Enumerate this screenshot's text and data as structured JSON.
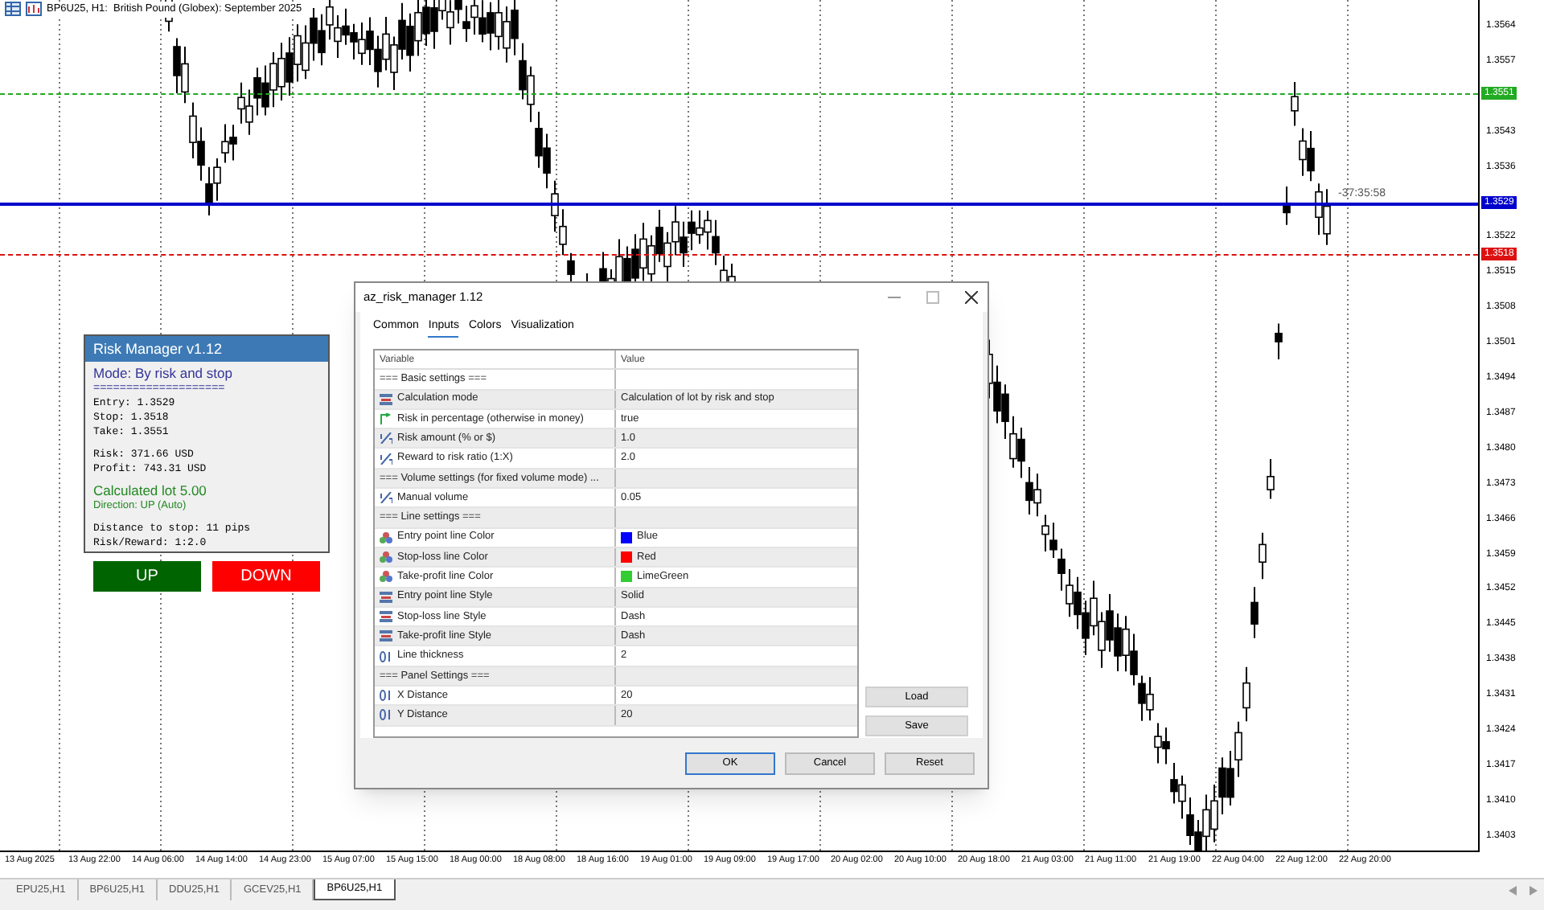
{
  "chart": {
    "title": "BP6U25, H1:  British Pound (Globex): September 2025",
    "price_labels": [
      "1.3564",
      "1.3557",
      "1.3543",
      "1.3536",
      "1.3522",
      "1.3515",
      "1.3508",
      "1.3501",
      "1.3494",
      "1.3487",
      "1.3480",
      "1.3473",
      "1.3466",
      "1.3459",
      "1.3452",
      "1.3445",
      "1.3438",
      "1.3431",
      "1.3424",
      "1.3417",
      "1.3410",
      "1.3403"
    ],
    "levels": [
      {
        "kind": "take",
        "text": "1.3551",
        "color": "#22aa22"
      },
      {
        "kind": "entry",
        "text": "1.3529",
        "color": "#0000cc"
      },
      {
        "kind": "stop",
        "text": "1.3518",
        "color": "#dd1111"
      }
    ],
    "timer": "-37:35:58",
    "time_labels": [
      "13 Aug 2025",
      "13 Aug 22:00",
      "14 Aug 06:00",
      "14 Aug 14:00",
      "14 Aug 23:00",
      "15 Aug 07:00",
      "15 Aug 15:00",
      "18 Aug 00:00",
      "18 Aug 08:00",
      "18 Aug 16:00",
      "19 Aug 01:00",
      "19 Aug 09:00",
      "19 Aug 17:00",
      "20 Aug 02:00",
      "20 Aug 10:00",
      "20 Aug 18:00",
      "21 Aug 03:00",
      "21 Aug 11:00",
      "21 Aug 19:00",
      "22 Aug 04:00",
      "22 Aug 12:00",
      "22 Aug 20:00"
    ]
  },
  "risk_panel": {
    "title": "Risk Manager v1.12",
    "groups": [
      [
        {
          "kind": "mode",
          "text": "Mode: By risk and stop"
        },
        {
          "kind": "rule",
          "text": "===================="
        },
        {
          "kind": "mono",
          "text": "Entry: 1.3529"
        },
        {
          "kind": "mono",
          "text": "Stop: 1.3518"
        },
        {
          "kind": "mono",
          "text": "Take: 1.3551"
        }
      ],
      [
        {
          "kind": "mono",
          "text": "Risk: 371.66 USD"
        },
        {
          "kind": "mono",
          "text": "Profit: 743.31 USD"
        }
      ],
      [
        {
          "kind": "lot",
          "text": "Calculated lot 5.00"
        },
        {
          "kind": "direction",
          "text": "Direction: UP (Auto)"
        }
      ],
      [
        {
          "kind": "mono",
          "text": "Distance to stop: 11 pips"
        },
        {
          "kind": "mono",
          "text": "Risk/Reward: 1:2.0"
        }
      ]
    ],
    "buttons": [
      {
        "label": "UP",
        "color": "#006400"
      },
      {
        "label": "DOWN",
        "color": "#ff0000"
      }
    ]
  },
  "dialog": {
    "title": "az_risk_manager 1.12",
    "tabs": [
      {
        "label": "Common",
        "selected": false
      },
      {
        "label": "Inputs",
        "selected": true
      },
      {
        "label": "Colors",
        "selected": false
      },
      {
        "label": "Visualization",
        "selected": false
      }
    ],
    "columns": [
      "Variable",
      "Value"
    ],
    "rows": [
      {
        "kind": "section",
        "variable": "=== Basic settings ==="
      },
      {
        "kind": "enum",
        "variable": "Calculation mode",
        "value": "Calculation of lot by risk and stop"
      },
      {
        "kind": "bool",
        "variable": "Risk in percentage (otherwise in money)",
        "value": "true"
      },
      {
        "kind": "double",
        "variable": "Risk amount (% or $)",
        "value": "1.0"
      },
      {
        "kind": "double",
        "variable": "Reward to risk ratio (1:X)",
        "value": "2.0"
      },
      {
        "kind": "section",
        "variable": "=== Volume settings (for fixed volume mode) ..."
      },
      {
        "kind": "double",
        "variable": "Manual volume",
        "value": "0.05"
      },
      {
        "kind": "section",
        "variable": "=== Line settings ==="
      },
      {
        "kind": "color",
        "variable": "Entry point line Color",
        "value": "Blue",
        "color": "#0000ff"
      },
      {
        "kind": "color",
        "variable": "Stop-loss line Color",
        "value": "Red",
        "color": "#ff0000"
      },
      {
        "kind": "color",
        "variable": "Take-profit line Color",
        "value": "LimeGreen",
        "color": "#32cd32"
      },
      {
        "kind": "enum",
        "variable": "Entry point line Style",
        "value": "Solid"
      },
      {
        "kind": "enum",
        "variable": "Stop-loss line Style",
        "value": "Dash"
      },
      {
        "kind": "enum",
        "variable": "Take-profit line Style",
        "value": "Dash"
      },
      {
        "kind": "int",
        "variable": "Line thickness",
        "value": "2"
      },
      {
        "kind": "section",
        "variable": "=== Panel Settings ==="
      },
      {
        "kind": "int",
        "variable": "X Distance",
        "value": "20"
      },
      {
        "kind": "int",
        "variable": "Y Distance",
        "value": "20"
      }
    ],
    "side_buttons": [
      "Load",
      "Save"
    ],
    "buttons": [
      {
        "label": "OK",
        "default": true
      },
      {
        "label": "Cancel",
        "default": false
      },
      {
        "label": "Reset",
        "default": false
      }
    ]
  },
  "symbol_tabs": [
    {
      "label": "EPU25,H1",
      "selected": false
    },
    {
      "label": "BP6U25,H1",
      "selected": false
    },
    {
      "label": "DDU25,H1",
      "selected": false
    },
    {
      "label": "GCEV25,H1",
      "selected": false
    },
    {
      "label": "BP6U25,H1",
      "selected": true
    }
  ]
}
